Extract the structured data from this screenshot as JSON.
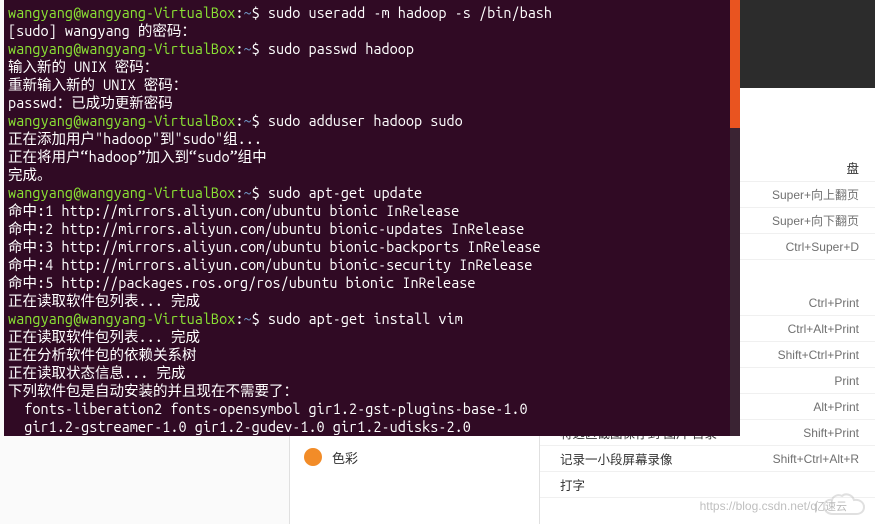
{
  "prompt": {
    "user_host": "wangyang@wangyang-VirtualBox",
    "separator": ":",
    "cwd": "~",
    "symbol": "$"
  },
  "lines": [
    {
      "type": "prompt",
      "cmd": "sudo useradd -m hadoop -s /bin/bash"
    },
    {
      "type": "out",
      "text": "[sudo] wangyang 的密码："
    },
    {
      "type": "prompt",
      "cmd": "sudo passwd hadoop"
    },
    {
      "type": "out",
      "text": "输入新的 UNIX 密码："
    },
    {
      "type": "out",
      "text": "重新输入新的 UNIX 密码："
    },
    {
      "type": "out",
      "text": "passwd：已成功更新密码"
    },
    {
      "type": "prompt",
      "cmd": "sudo adduser hadoop sudo"
    },
    {
      "type": "out",
      "text": "正在添加用户\"hadoop\"到\"sudo\"组..."
    },
    {
      "type": "out",
      "text": "正在将用户“hadoop”加入到“sudo”组中"
    },
    {
      "type": "out",
      "text": "完成。"
    },
    {
      "type": "prompt",
      "cmd": "sudo apt-get update"
    },
    {
      "type": "out",
      "text": "命中:1 http://mirrors.aliyun.com/ubuntu bionic InRelease"
    },
    {
      "type": "out",
      "text": "命中:2 http://mirrors.aliyun.com/ubuntu bionic-updates InRelease"
    },
    {
      "type": "out",
      "text": "命中:3 http://mirrors.aliyun.com/ubuntu bionic-backports InRelease"
    },
    {
      "type": "out",
      "text": "命中:4 http://mirrors.aliyun.com/ubuntu bionic-security InRelease"
    },
    {
      "type": "out",
      "text": "命中:5 http://packages.ros.org/ros/ubuntu bionic InRelease"
    },
    {
      "type": "out",
      "text": "正在读取软件包列表... 完成"
    },
    {
      "type": "prompt",
      "cmd": "sudo apt-get install vim"
    },
    {
      "type": "out",
      "text": "正在读取软件包列表... 完成"
    },
    {
      "type": "out",
      "text": "正在分析软件包的依赖关系树"
    },
    {
      "type": "out",
      "text": "正在读取状态信息... 完成"
    },
    {
      "type": "out",
      "text": "下列软件包是自动安装的并且现在不需要了："
    },
    {
      "type": "out",
      "text": "  fonts-liberation2 fonts-opensymbol gir1.2-gst-plugins-base-1.0"
    },
    {
      "type": "out",
      "text": "  gir1.2-gstreamer-1.0 gir1.2-gudev-1.0 gir1.2-udisks-2.0"
    }
  ],
  "right_panel": {
    "misc_label": "盘",
    "rows": [
      {
        "label": "",
        "key": "Super+向上翻页"
      },
      {
        "label": "",
        "key": "Super+向下翻页"
      },
      {
        "label": "",
        "key": "Ctrl+Super+D"
      }
    ],
    "section2_rows": [
      {
        "label": "",
        "key": "Ctrl+Print"
      },
      {
        "label": "",
        "key": "Ctrl+Alt+Print"
      },
      {
        "label": "",
        "key": "Shift+Ctrl+Print"
      },
      {
        "label": "",
        "key": "Print"
      },
      {
        "label": "",
        "key": "Alt+Print"
      },
      {
        "label": "将选区截图保存到 图片 目录",
        "key": "Shift+Print"
      },
      {
        "label": "记录一小段屏幕录像",
        "key": "Shift+Ctrl+Alt+R"
      }
    ],
    "section3_rows": [
      {
        "label": "打字",
        "key": ""
      }
    ]
  },
  "center_panel": {
    "color_label": "色彩",
    "color_dot": "#f28c28"
  },
  "watermark": {
    "url": "https://blog.csdn.net/q",
    "brand": "亿速云"
  }
}
